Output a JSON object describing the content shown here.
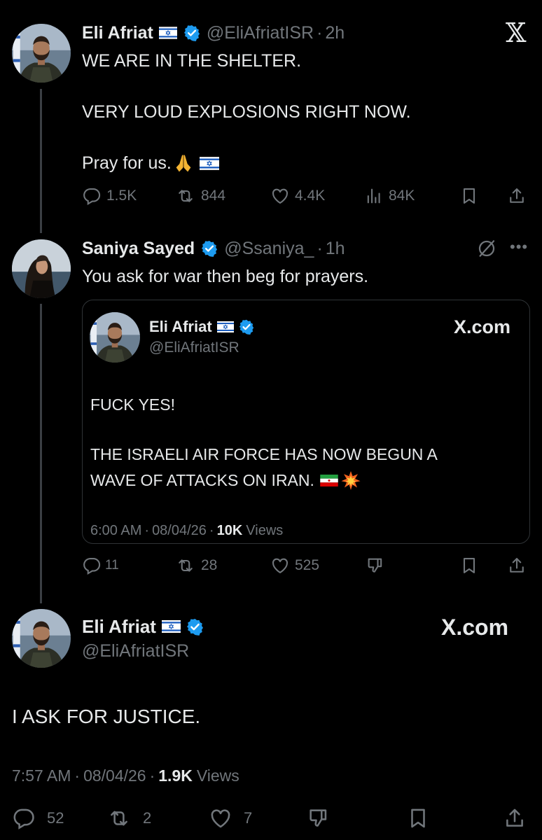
{
  "tweet1": {
    "name": "Eli Afriat",
    "handle": "@EliAfriatISR",
    "time": "2h",
    "lines": [
      "WE ARE IN THE SHELTER.",
      "VERY LOUD EXPLOSIONS RIGHT NOW.",
      "Pray for us."
    ],
    "replies": "1.5K",
    "reposts": "844",
    "likes": "4.4K",
    "views": "84K"
  },
  "reply": {
    "name": "Saniya Sayed",
    "handle": "@Ssaniya_",
    "time": "1h",
    "text": "You ask for war then beg for prayers.",
    "replies": "11",
    "reposts": "28",
    "likes": "525"
  },
  "quoted": {
    "name": "Eli Afriat",
    "handle": "@EliAfriatISR",
    "site": "X.com",
    "line1": "FUCK YES!",
    "line2": "THE ISRAELI AIR FORCE HAS NOW BEGUN A",
    "line3": "WAVE OF ATTACKS ON IRAN.",
    "meta_time": "6:00 AM",
    "meta_date": "08/04/26",
    "views_count": "10K",
    "views_label": "Views"
  },
  "main": {
    "name": "Eli Afriat",
    "handle": "@EliAfriatISR",
    "site": "X.com",
    "text": "I ASK FOR JUSTICE.",
    "meta_time": "7:57 AM",
    "meta_date": "08/04/26",
    "views_count": "1.9K",
    "views_label": "Views",
    "replies": "52",
    "reposts": "2",
    "likes": "7"
  },
  "dot": "·",
  "colors": {
    "background": "#000000",
    "text": "#e7e9ea",
    "muted": "#71767b",
    "verified": "#1d9bf0",
    "border": "#2f3336"
  },
  "icons": [
    "x-logo-icon",
    "reply-icon",
    "repost-icon",
    "like-icon",
    "views-icon",
    "bookmark-icon",
    "share-icon",
    "verified-icon",
    "israel-flag-icon",
    "pray-emoji-icon",
    "iran-flag-icon",
    "collision-emoji-icon",
    "grok-icon",
    "more-icon",
    "dislike-icon"
  ]
}
